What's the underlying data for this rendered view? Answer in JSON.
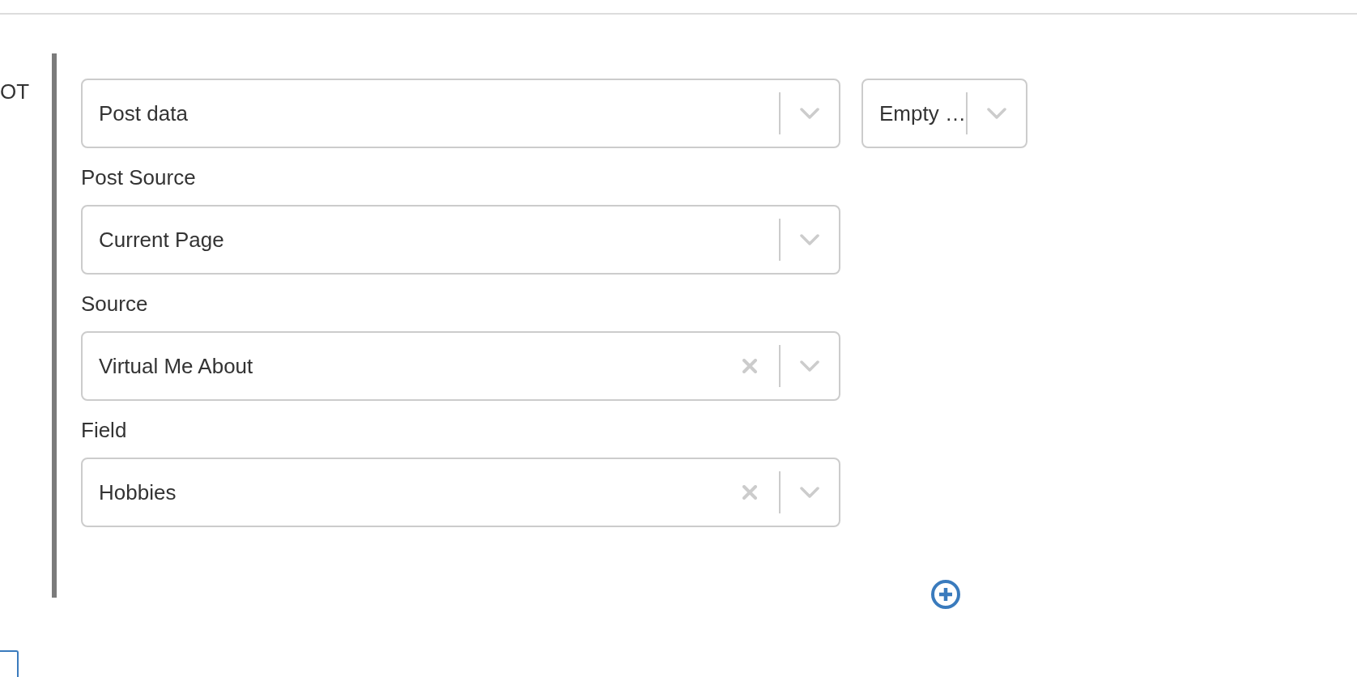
{
  "side_label": "OT",
  "first_row": {
    "select": {
      "value": "Post data",
      "clearable": false
    },
    "operator_select": {
      "value": "Empty …",
      "clearable": false
    }
  },
  "fields": [
    {
      "label": "Post Source",
      "value": "Current Page",
      "clearable": false
    },
    {
      "label": "Source",
      "value": "Virtual Me About",
      "clearable": true
    },
    {
      "label": "Field",
      "value": "Hobbies",
      "clearable": true
    }
  ]
}
